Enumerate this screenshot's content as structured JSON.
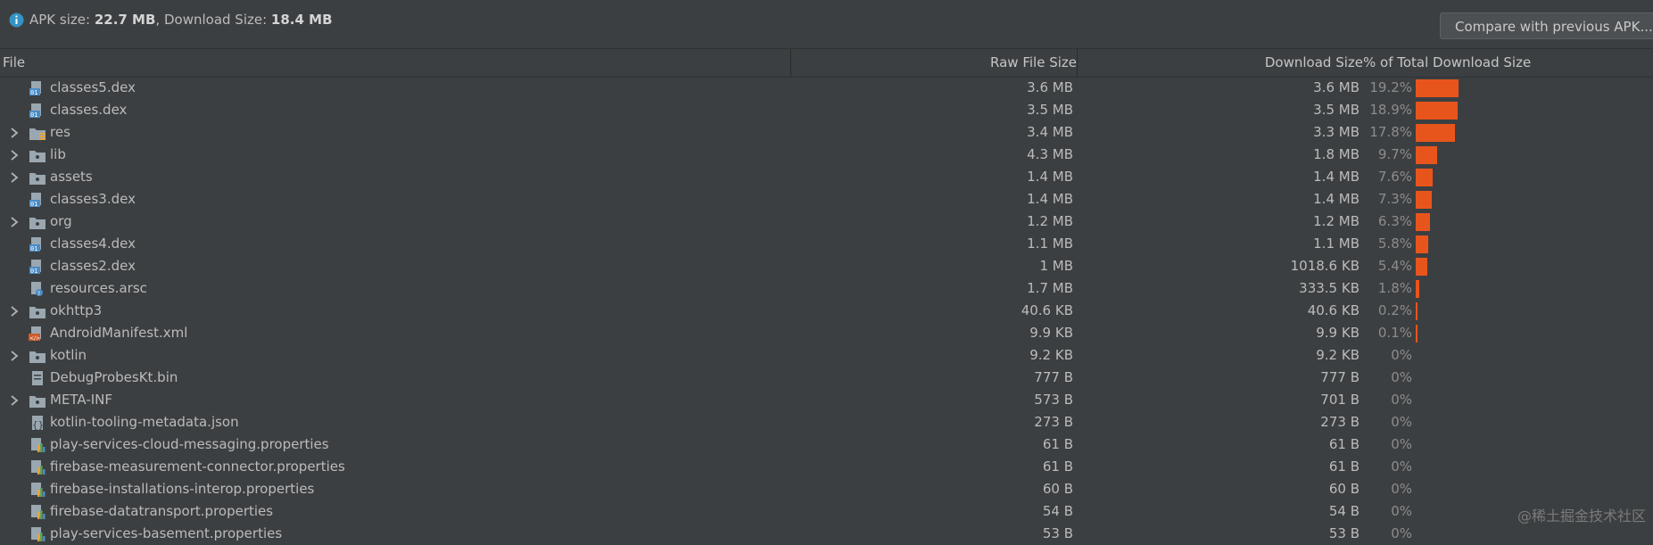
{
  "summary": {
    "apk_label": "APK size: ",
    "apk_value": "22.7 MB",
    "sep": ", ",
    "dl_label": "Download Size: ",
    "dl_value": "18.4 MB"
  },
  "compare_button": "Compare with previous APK...",
  "columns": {
    "file": "File",
    "raw": "Raw File Size",
    "download": "Download Size",
    "percent": "% of Total Download Size"
  },
  "colors": {
    "bar": "#e8551c",
    "background": "#3c3f41"
  },
  "rows": [
    {
      "name": "classes5.dex",
      "icon": "dex-file-icon",
      "expandable": false,
      "raw": "3.6 MB",
      "download": "3.6 MB",
      "percent": "19.2%",
      "share": 19.2
    },
    {
      "name": "classes.dex",
      "icon": "dex-file-icon",
      "expandable": false,
      "raw": "3.5 MB",
      "download": "3.5 MB",
      "percent": "18.9%",
      "share": 18.9
    },
    {
      "name": "res",
      "icon": "resource-folder-icon",
      "expandable": true,
      "raw": "3.4 MB",
      "download": "3.3 MB",
      "percent": "17.8%",
      "share": 17.8
    },
    {
      "name": "lib",
      "icon": "folder-icon",
      "expandable": true,
      "raw": "4.3 MB",
      "download": "1.8 MB",
      "percent": "9.7%",
      "share": 9.7
    },
    {
      "name": "assets",
      "icon": "folder-icon",
      "expandable": true,
      "raw": "1.4 MB",
      "download": "1.4 MB",
      "percent": "7.6%",
      "share": 7.6
    },
    {
      "name": "classes3.dex",
      "icon": "dex-file-icon",
      "expandable": false,
      "raw": "1.4 MB",
      "download": "1.4 MB",
      "percent": "7.3%",
      "share": 7.3
    },
    {
      "name": "org",
      "icon": "folder-icon",
      "expandable": true,
      "raw": "1.2 MB",
      "download": "1.2 MB",
      "percent": "6.3%",
      "share": 6.3
    },
    {
      "name": "classes4.dex",
      "icon": "dex-file-icon",
      "expandable": false,
      "raw": "1.1 MB",
      "download": "1.1 MB",
      "percent": "5.8%",
      "share": 5.8
    },
    {
      "name": "classes2.dex",
      "icon": "dex-file-icon",
      "expandable": false,
      "raw": "1 MB",
      "download": "1018.6 KB",
      "percent": "5.4%",
      "share": 5.4
    },
    {
      "name": "resources.arsc",
      "icon": "arsc-file-icon",
      "expandable": false,
      "raw": "1.7 MB",
      "download": "333.5 KB",
      "percent": "1.8%",
      "share": 1.8
    },
    {
      "name": "okhttp3",
      "icon": "folder-icon",
      "expandable": true,
      "raw": "40.6 KB",
      "download": "40.6 KB",
      "percent": "0.2%",
      "share": 0.2
    },
    {
      "name": "AndroidManifest.xml",
      "icon": "xml-file-icon",
      "expandable": false,
      "raw": "9.9 KB",
      "download": "9.9 KB",
      "percent": "0.1%",
      "share": 0.1
    },
    {
      "name": "kotlin",
      "icon": "folder-icon",
      "expandable": true,
      "raw": "9.2 KB",
      "download": "9.2 KB",
      "percent": "0%",
      "share": 0
    },
    {
      "name": "DebugProbesKt.bin",
      "icon": "file-icon",
      "expandable": false,
      "raw": "777 B",
      "download": "777 B",
      "percent": "0%",
      "share": 0
    },
    {
      "name": "META-INF",
      "icon": "folder-icon",
      "expandable": true,
      "raw": "573 B",
      "download": "701 B",
      "percent": "0%",
      "share": 0
    },
    {
      "name": "kotlin-tooling-metadata.json",
      "icon": "json-file-icon",
      "expandable": false,
      "raw": "273 B",
      "download": "273 B",
      "percent": "0%",
      "share": 0
    },
    {
      "name": "play-services-cloud-messaging.properties",
      "icon": "properties-file-icon",
      "expandable": false,
      "raw": "61 B",
      "download": "61 B",
      "percent": "0%",
      "share": 0
    },
    {
      "name": "firebase-measurement-connector.properties",
      "icon": "properties-file-icon",
      "expandable": false,
      "raw": "61 B",
      "download": "61 B",
      "percent": "0%",
      "share": 0
    },
    {
      "name": "firebase-installations-interop.properties",
      "icon": "properties-file-icon",
      "expandable": false,
      "raw": "60 B",
      "download": "60 B",
      "percent": "0%",
      "share": 0
    },
    {
      "name": "firebase-datatransport.properties",
      "icon": "properties-file-icon",
      "expandable": false,
      "raw": "54 B",
      "download": "54 B",
      "percent": "0%",
      "share": 0
    },
    {
      "name": "play-services-basement.properties",
      "icon": "properties-file-icon",
      "expandable": false,
      "raw": "53 B",
      "download": "53 B",
      "percent": "0%",
      "share": 0
    }
  ],
  "watermark": "@稀土掘金技术社区"
}
